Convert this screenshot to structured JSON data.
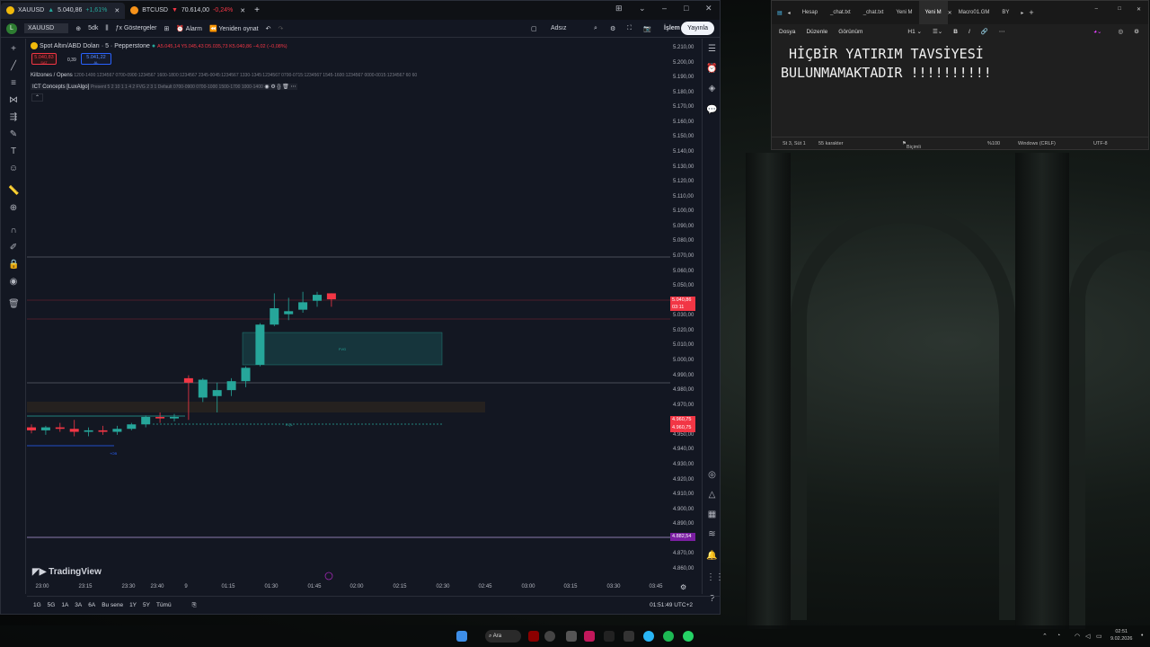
{
  "tradingview": {
    "tabs": [
      {
        "symbol": "XAUUSD",
        "price": "5.040,86",
        "change": "+1,61%",
        "dir": "up",
        "coin_color": "#f0b90b"
      },
      {
        "symbol": "BTCUSD",
        "price": "70.614,00",
        "change": "-0,24%",
        "dir": "dn",
        "coin_color": "#f7931a"
      }
    ],
    "toolbar": {
      "symbol": "XAUUSD",
      "interval": "5dk",
      "indicators": "Göstergeler",
      "alarm": "Alarm",
      "replay": "Yeniden oynat",
      "layout_name": "Adsız",
      "trade": "İşlem",
      "publish": "Yayınla"
    },
    "legend": {
      "title": "Spot Altın/ABD Doları · 5 · Pepperstone",
      "ohlc": "A5.045,14 Y5.045,43 D5.035,73 K5.040,86 −4,02 (−0,08%)",
      "sell_price": "5.040,83",
      "sell_label": "SAT",
      "spread": "0,39",
      "buy_price": "5.041,22",
      "buy_label": "AL"
    },
    "indicators": [
      {
        "name": "Killzones / Opens",
        "params": "1200-1400:1234567 0700-0900:1234567 1600-1800:1234567 2345-0045:1234567 1330-1345:1234567 0700-0715:1234567 1545-1600:1234567 0000-0015:1234567 60 60"
      },
      {
        "name": "ICT Concepts [LuxAlgo]",
        "params": "Present 5 2 10 1 1 4 2 FVG 2 3 1 Default 0700-0900 0700-1000 1500-1700 1000-1400"
      }
    ],
    "chart_data": {
      "type": "candlestick",
      "ylim": [
        4860,
        5210
      ],
      "y_ticks": [
        "5.210,00",
        "5.200,00",
        "5.190,00",
        "5.180,00",
        "5.170,00",
        "5.160,00",
        "5.150,00",
        "5.140,00",
        "5.130,00",
        "5.120,00",
        "5.110,00",
        "5.100,00",
        "5.090,00",
        "5.080,00",
        "5.070,00",
        "5.060,00",
        "5.050,00",
        "5.040,00",
        "5.030,00",
        "5.020,00",
        "5.010,00",
        "5.000,00",
        "4.990,00",
        "4.980,00",
        "4.970,00",
        "4.960,00",
        "4.950,00",
        "4.940,00",
        "4.930,00",
        "4.920,00",
        "4.910,00",
        "4.900,00",
        "4.890,00",
        "4.880,00",
        "4.870,00",
        "4.860,00"
      ],
      "x_ticks": [
        "23:00",
        "23:15",
        "23:30",
        "23:40",
        "9",
        "01:15",
        "01:30",
        "01:45",
        "02:00",
        "02:15",
        "02:30",
        "02:45",
        "03:00",
        "03:15",
        "03:30",
        "03:45"
      ],
      "candles": [
        {
          "o": 4955,
          "h": 4957,
          "l": 4951,
          "c": 4953
        },
        {
          "o": 4953,
          "h": 4956,
          "l": 4950,
          "c": 4955
        },
        {
          "o": 4955,
          "h": 4958,
          "l": 4952,
          "c": 4954
        },
        {
          "o": 4954,
          "h": 4960,
          "l": 4949,
          "c": 4952
        },
        {
          "o": 4952,
          "h": 4955,
          "l": 4949,
          "c": 4953
        },
        {
          "o": 4953,
          "h": 4956,
          "l": 4950,
          "c": 4952
        },
        {
          "o": 4952,
          "h": 4956,
          "l": 4950,
          "c": 4954
        },
        {
          "o": 4954,
          "h": 4958,
          "l": 4953,
          "c": 4957
        },
        {
          "o": 4957,
          "h": 4963,
          "l": 4955,
          "c": 4962
        },
        {
          "o": 4962,
          "h": 4965,
          "l": 4958,
          "c": 4961
        },
        {
          "o": 4961,
          "h": 4964,
          "l": 4959,
          "c": 4962
        },
        {
          "o": 4988,
          "h": 4990,
          "l": 4960,
          "c": 4985
        },
        {
          "o": 4975,
          "h": 4988,
          "l": 4972,
          "c": 4987
        },
        {
          "o": 4976,
          "h": 4985,
          "l": 4965,
          "c": 4980
        },
        {
          "o": 4980,
          "h": 4988,
          "l": 4976,
          "c": 4986
        },
        {
          "o": 4986,
          "h": 4996,
          "l": 4982,
          "c": 4995
        },
        {
          "o": 4997,
          "h": 5025,
          "l": 4996,
          "c": 5024
        },
        {
          "o": 5024,
          "h": 5045,
          "l": 5023,
          "c": 5035
        },
        {
          "o": 5031,
          "h": 5042,
          "l": 5027,
          "c": 5033
        },
        {
          "o": 5034,
          "h": 5046,
          "l": 5032,
          "c": 5039
        },
        {
          "o": 5040,
          "h": 5046,
          "l": 5036,
          "c": 5044
        },
        {
          "o": 5045,
          "h": 5045,
          "l": 5036,
          "c": 5041
        }
      ],
      "current_price": "5.040,86",
      "current_countdown": "03:11",
      "levels": [
        {
          "label": "4.960,75",
          "value": 4960.75,
          "color": "#f23645"
        },
        {
          "label": "4.960,75",
          "value": 4958.5,
          "color": "#f23645"
        },
        {
          "label": "4.882,54",
          "value": 4882.54,
          "color": "#7b1fa2"
        }
      ],
      "fvg_label": "FVG",
      "eq_label": "EQL",
      "zone_label": "+OB"
    },
    "bottom": {
      "ranges": [
        "1G",
        "5G",
        "1A",
        "3A",
        "6A",
        "Bu sene",
        "1Y",
        "5Y",
        "Tümü"
      ],
      "clock": "01:51:49 UTC+2",
      "logo": "TradingView"
    }
  },
  "notepad": {
    "tabs": [
      "Hesap",
      "_chat.txt",
      "_chat.txt",
      "Yeni M",
      "Yeni M",
      "Macro01.GM",
      "BY"
    ],
    "menu": [
      "Dosya",
      "Düzenle",
      "Görünüm"
    ],
    "heading": "H1",
    "text": " HİÇBİR YATIRIM TAVSİYESİ\nBULUNMAMAKTADIR !!!!!!!!!!",
    "status": {
      "position": "St 3, Süt 1",
      "chars": "55 karakter",
      "format": "Biçimli",
      "zoom": "%100",
      "eol": "Windows (CRLF)",
      "encoding": "UTF-8"
    }
  },
  "taskbar": {
    "search": "Ara",
    "time": "02:51",
    "date": "9.02.2026"
  }
}
